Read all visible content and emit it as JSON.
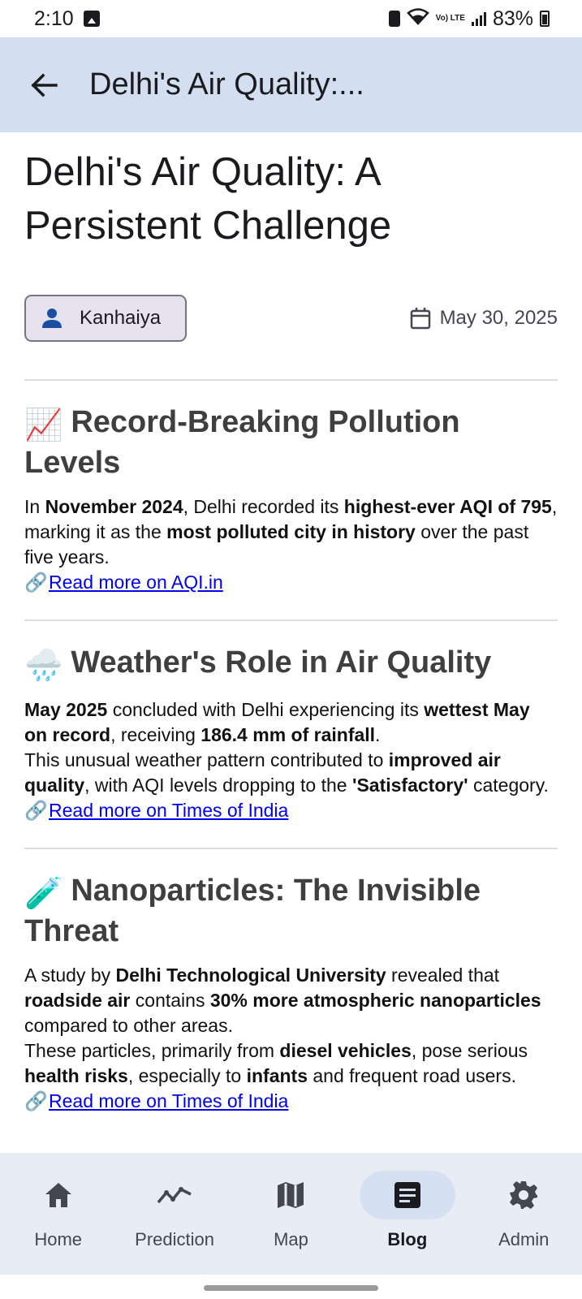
{
  "status_bar": {
    "time": "2:10",
    "battery": "83%",
    "network": "Vo) LTE"
  },
  "app_bar": {
    "title": "Delhi's Air Quality:..."
  },
  "post": {
    "title": "Delhi's Air Quality: A Persistent Challenge",
    "author": "Kanhaiya",
    "date": "May 30, 2025"
  },
  "sections": [
    {
      "emoji": "📈",
      "heading": "Record-Breaking Pollution Levels",
      "body_html": "In <b>November 2024</b>, Delhi recorded its <b>highest-ever AQI of 795</b>, marking it as the <b>most polluted city in history</b> over the past five years.",
      "link_emoji": "🔗",
      "link_text": "Read more on AQI.in"
    },
    {
      "emoji": "🌧️",
      "heading": "Weather's Role in Air Quality",
      "body_html": "<b>May 2025</b> concluded with Delhi experiencing its <b>wettest May on record</b>, receiving <b>186.4 mm of rainfall</b>.<br>This unusual weather pattern contributed to <b>improved air quality</b>, with AQI levels dropping to the <b>'Satisfactory'</b> category.",
      "link_emoji": "🔗",
      "link_text": "Read more on Times of India"
    },
    {
      "emoji": "🧪",
      "heading": "Nanoparticles: The Invisible Threat",
      "body_html": "A study by <b>Delhi Technological University</b> revealed that <b>roadside air</b> contains <b>30% more atmospheric nanoparticles</b> compared to other areas.<br>These particles, primarily from <b>diesel vehicles</b>, pose serious <b>health risks</b>, especially to <b>infants</b> and frequent road users.",
      "link_emoji": "🔗",
      "link_text": "Read more on Times of India"
    }
  ],
  "bottom_nav": {
    "items": [
      {
        "label": "Home",
        "icon": "home-icon"
      },
      {
        "label": "Prediction",
        "icon": "trend-icon"
      },
      {
        "label": "Map",
        "icon": "map-icon"
      },
      {
        "label": "Blog",
        "icon": "article-icon",
        "active": true
      },
      {
        "label": "Admin",
        "icon": "gear-icon"
      }
    ]
  },
  "colors": {
    "app_bar_bg": "#d3dff0",
    "nav_bg": "#e7ecf5",
    "chip_bg": "#e8e1f0",
    "accent_blue": "#1a4fa3",
    "link": "#0000ee"
  }
}
